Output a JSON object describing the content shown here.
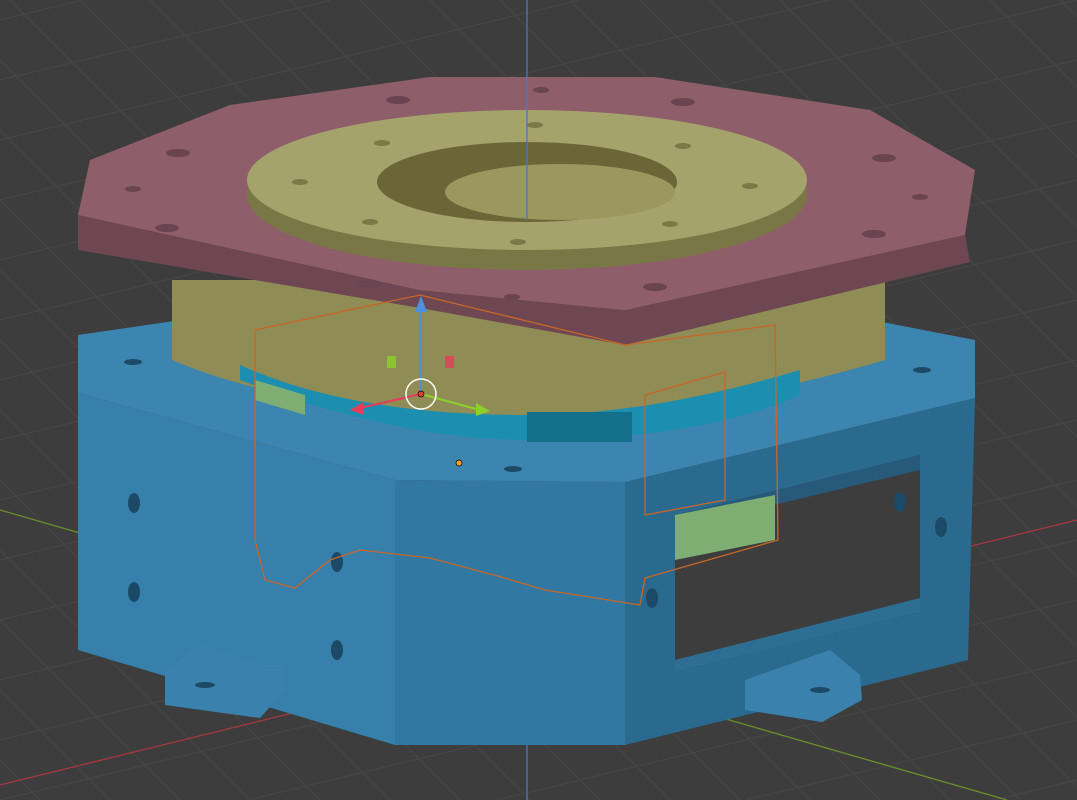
{
  "viewport": {
    "mode": "3d-viewport",
    "background_color": "#3d3d3d",
    "grid_color": "#464646",
    "axis_colors": {
      "x": "#a8383f",
      "y": "#6a8f2a",
      "z": "#4a78b8"
    }
  },
  "model": {
    "parts": [
      {
        "name": "base-housing",
        "color": "#3a82ad"
      },
      {
        "name": "octagon-flange-plate",
        "color": "#8e5e6a"
      },
      {
        "name": "bearing-ring",
        "color": "#a4a36b"
      },
      {
        "name": "inner-band",
        "color": "#1c8fb0"
      }
    ],
    "selection_outline_color": "#e0701c"
  },
  "gizmo": {
    "icon": "transform-gizmo",
    "origin_color": "#e63c3c"
  }
}
